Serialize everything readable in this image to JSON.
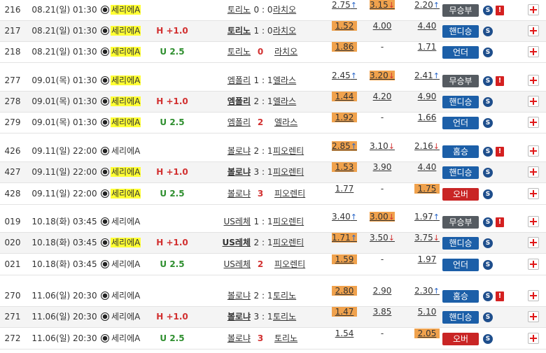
{
  "rows": [
    {
      "num": "216",
      "date": "08.21(일) 01:30",
      "league": "세리에A",
      "league_hl": true,
      "handicap": "",
      "home": "토리노",
      "score": "0 : 0",
      "away": "라치오",
      "odd1": "2.75",
      "odd1_arrow": "↑",
      "odd2": "3.15",
      "odd2_arrow": "↓",
      "odd2_box": true,
      "odd3": "2.20",
      "odd3_arrow": "↑",
      "bet": "무승부",
      "bet_color": "gray",
      "excl": true
    },
    {
      "num": "217",
      "date": "08.21(일) 01:30",
      "league": "세리에A",
      "league_hl": true,
      "handicap": "H +1.0",
      "home": "토리노",
      "score": "1 : 0",
      "away": "라치오",
      "odd1": "1.52",
      "odd1_box": true,
      "odd2": "4.00",
      "odd3": "4.40",
      "bet": "핸디승",
      "bet_color": "blue"
    },
    {
      "num": "218",
      "date": "08.21(일) 01:30",
      "league": "세리에A",
      "league_hl": true,
      "handicap": "U 2.5",
      "home": "토리노",
      "score": "0",
      "away": "라치오",
      "odd1": "1.86",
      "odd1_box": true,
      "odd2": "-",
      "odd3": "1.71",
      "bet": "언더",
      "bet_color": "blue"
    },
    {
      "num": "277",
      "date": "09.01(목) 01:30",
      "league": "세리에A",
      "league_hl": true,
      "handicap": "",
      "home": "엠폴리",
      "score": "1 : 1",
      "away": "엘라스",
      "odd1": "2.45",
      "odd1_arrow": "↑",
      "odd2": "3.20",
      "odd2_arrow": "↓",
      "odd2_box": true,
      "odd3": "2.41",
      "odd3_arrow": "↑",
      "bet": "무승부",
      "bet_color": "gray",
      "excl": true
    },
    {
      "num": "278",
      "date": "09.01(목) 01:30",
      "league": "세리에A",
      "league_hl": true,
      "handicap": "H +1.0",
      "home": "엠폴리",
      "score": "2 : 1",
      "away": "엘라스",
      "odd1": "1.44",
      "odd1_box": true,
      "odd2": "4.20",
      "odd3": "4.90",
      "bet": "핸디승",
      "bet_color": "blue"
    },
    {
      "num": "279",
      "date": "09.01(목) 01:30",
      "league": "세리에A",
      "league_hl": true,
      "handicap": "U 2.5",
      "home": "엠폴리",
      "score": "2",
      "away": "엘라스",
      "odd1": "1.92",
      "odd1_box": true,
      "odd2": "-",
      "odd3": "1.66",
      "bet": "언더",
      "bet_color": "blue"
    },
    {
      "num": "426",
      "date": "09.11(일) 22:00",
      "league": "세리에A",
      "league_hl": false,
      "handicap": "",
      "home": "볼로냐",
      "score": "2 : 1",
      "away": "피오렌티",
      "odd1": "2.85",
      "odd1_arrow": "↑",
      "odd1_box": true,
      "odd2": "3.10",
      "odd2_arrow": "↓",
      "odd3": "2.16",
      "odd3_arrow": "↓",
      "bet": "홈승",
      "bet_color": "blue",
      "excl": true
    },
    {
      "num": "427",
      "date": "09.11(일) 22:00",
      "league": "세리에A",
      "league_hl": true,
      "handicap": "H +1.0",
      "home": "볼로냐",
      "score": "3 : 1",
      "away": "피오렌티",
      "odd1": "1.53",
      "odd1_box": true,
      "odd2": "3.90",
      "odd3": "4.40",
      "bet": "핸디승",
      "bet_color": "blue"
    },
    {
      "num": "428",
      "date": "09.11(일) 22:00",
      "league": "세리에A",
      "league_hl": true,
      "handicap": "U 2.5",
      "home": "볼로냐",
      "score": "3",
      "away": "피오렌티",
      "odd1": "1.77",
      "odd2": "-",
      "odd3": "1.75",
      "odd3_box": true,
      "bet": "오버",
      "bet_color": "red"
    },
    {
      "num": "019",
      "date": "10.18(화) 03:45",
      "league": "세리에A",
      "league_hl": false,
      "handicap": "",
      "home": "US레체",
      "score": "1 : 1",
      "away": "피오렌티",
      "odd1": "3.40",
      "odd1_arrow": "↑",
      "odd2": "3.00",
      "odd2_arrow": "↓",
      "odd2_box": true,
      "odd3": "1.97",
      "odd3_arrow": "↑",
      "bet": "무승부",
      "bet_color": "gray",
      "excl": true
    },
    {
      "num": "020",
      "date": "10.18(화) 03:45",
      "league": "세리에A",
      "league_hl": true,
      "handicap": "H +1.0",
      "home": "US레체",
      "score": "2 : 1",
      "away": "피오렌티",
      "odd1": "1.71",
      "odd1_arrow": "↑",
      "odd1_box": true,
      "odd2": "3.50",
      "odd2_arrow": "↓",
      "odd3": "3.75",
      "odd3_arrow": "↓",
      "bet": "핸디승",
      "bet_color": "blue"
    },
    {
      "num": "021",
      "date": "10.18(화) 03:45",
      "league": "세리에A",
      "league_hl": false,
      "handicap": "U 2.5",
      "home": "US레체",
      "score": "2",
      "away": "피오렌티",
      "odd1": "1.59",
      "odd1_box": true,
      "odd2": "-",
      "odd3": "1.97",
      "bet": "언더",
      "bet_color": "blue"
    },
    {
      "num": "270",
      "date": "11.06(일) 20:30",
      "league": "세리에A",
      "league_hl": false,
      "handicap": "",
      "home": "볼로냐",
      "score": "2 : 1",
      "away": "토리노",
      "odd1": "2.80",
      "odd1_box": true,
      "odd2": "2.90",
      "odd3": "2.30",
      "odd3_arrow": "↑",
      "bet": "홈승",
      "bet_color": "blue",
      "excl": true
    },
    {
      "num": "271",
      "date": "11.06(일) 20:30",
      "league": "세리에A",
      "league_hl": false,
      "handicap": "H +1.0",
      "home": "볼로냐",
      "score": "3 : 1",
      "away": "토리노",
      "odd1": "1.47",
      "odd1_box": true,
      "odd2": "3.85",
      "odd3": "5.10",
      "bet": "핸디승",
      "bet_color": "blue"
    },
    {
      "num": "272",
      "date": "11.06(일) 20:30",
      "league": "세리에A",
      "league_hl": false,
      "handicap": "U 2.5",
      "home": "볼로냐",
      "score": "3",
      "away": "토리노",
      "odd1": "1.54",
      "odd2": "-",
      "odd3": "2.05",
      "odd3_box": true,
      "bet": "오버",
      "bet_color": "red"
    }
  ],
  "icons": {
    "soccer": "soccer-ball-icon",
    "s_badge": "s-badge-icon",
    "warning": "warning-icon",
    "add": "add-plus-icon"
  },
  "colors": {
    "highlight": "#ffff33",
    "odd_box": "#f0a24d",
    "bet_gray": "#555b61",
    "bet_blue": "#1c5fa8",
    "bet_red": "#c92525",
    "handicap_red": "#d23030",
    "under_green": "#2f8f2f"
  }
}
